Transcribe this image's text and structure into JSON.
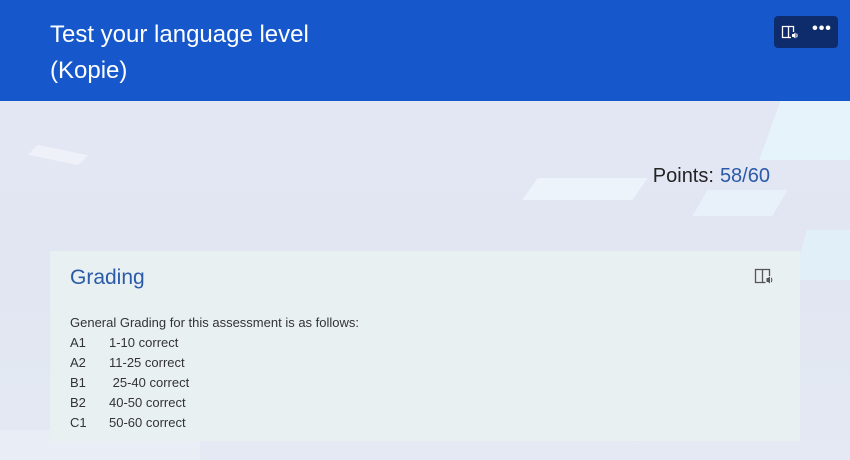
{
  "header": {
    "title_line1": "Test your language level",
    "title_line2": "(Kopie)",
    "background_color": "#1658cc",
    "tools": {
      "reader_icon": "immersive-reader-icon",
      "more_icon": "more-options-icon",
      "more_label": "•••"
    }
  },
  "score": {
    "label": "Points:",
    "value": "58/60"
  },
  "grading": {
    "title": "Grading",
    "reader_icon": "immersive-reader-icon",
    "intro": "General Grading for this assessment is as follows:",
    "rows": [
      {
        "level": "A1",
        "range": "1-10 correct"
      },
      {
        "level": "A2",
        "range": "11-25 correct"
      },
      {
        "level": "B1",
        "range": " 25-40 correct"
      },
      {
        "level": "B2",
        "range": "40-50 correct"
      },
      {
        "level": "C1",
        "range": "50-60 correct"
      }
    ]
  },
  "colors": {
    "accent": "#2b5aa8",
    "card_background": "#e8f0f2",
    "header_tools_background": "#0e2c6b"
  }
}
